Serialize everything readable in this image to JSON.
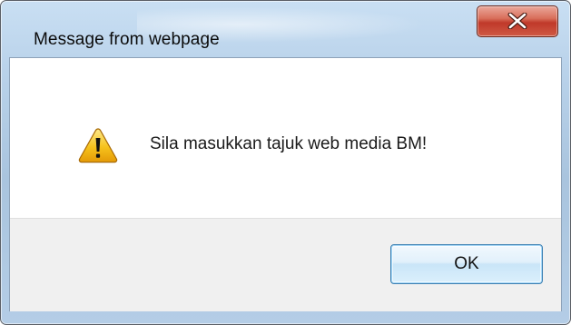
{
  "dialog": {
    "title": "Message from webpage",
    "message": "Sila masukkan tajuk web media BM!",
    "message_icon": "warning-icon",
    "close_icon": "close-icon"
  },
  "buttons": {
    "ok_label": "OK"
  },
  "colors": {
    "close_button": "#c9483a",
    "ok_button_border": "#3c7fb1",
    "warning_yellow": "#f6c21c"
  }
}
